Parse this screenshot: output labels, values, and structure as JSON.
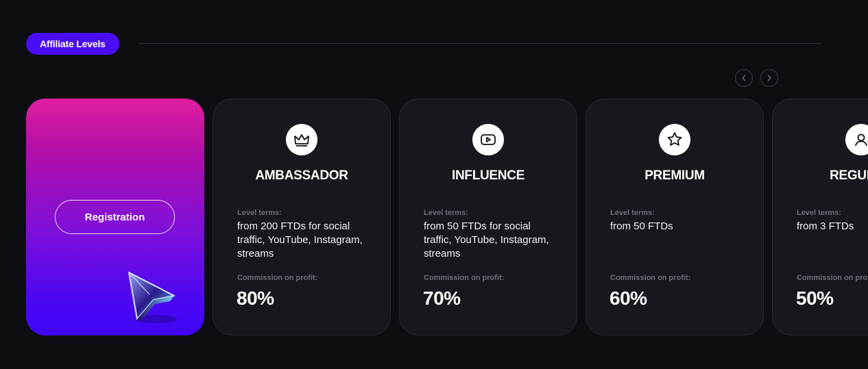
{
  "header": {
    "badge_label": "Affiliate Levels"
  },
  "carousel": {
    "prev_icon": "chevron-left-icon",
    "next_icon": "chevron-right-icon"
  },
  "promo": {
    "register_label": "Registration",
    "art_icon": "cursor-arrow-icon",
    "gradient": [
      "#e01fa0",
      "#b30ea8",
      "#7f10d8",
      "#4b07f2"
    ]
  },
  "levels": [
    {
      "name": "AMBASSADOR",
      "icon": "crown-icon",
      "terms_label": "Level terms:",
      "terms": "from 200 FTDs for social traffic, YouTube, Instagram, streams",
      "commission_label": "Commission on profit:",
      "commission": "80%"
    },
    {
      "name": "INFLUENCE",
      "icon": "youtube-play-icon",
      "terms_label": "Level terms:",
      "terms": "from 50 FTDs for social traffic, YouTube, Instagram, streams",
      "commission_label": "Commission on profit:",
      "commission": "70%"
    },
    {
      "name": "PREMIUM",
      "icon": "star-icon",
      "terms_label": "Level terms:",
      "terms": "from 50 FTDs",
      "commission_label": "Commission on profit:",
      "commission": "60%"
    },
    {
      "name": "REGULAR",
      "icon": "user-icon",
      "terms_label": "Level terms:",
      "terms": "from 3 FTDs",
      "commission_label": "Commission on profit:",
      "commission": "50%"
    }
  ],
  "colors": {
    "background": "#0d0e11",
    "card": "#16181d",
    "accent": "#4a0df5",
    "muted_text": "#6b6f78"
  }
}
